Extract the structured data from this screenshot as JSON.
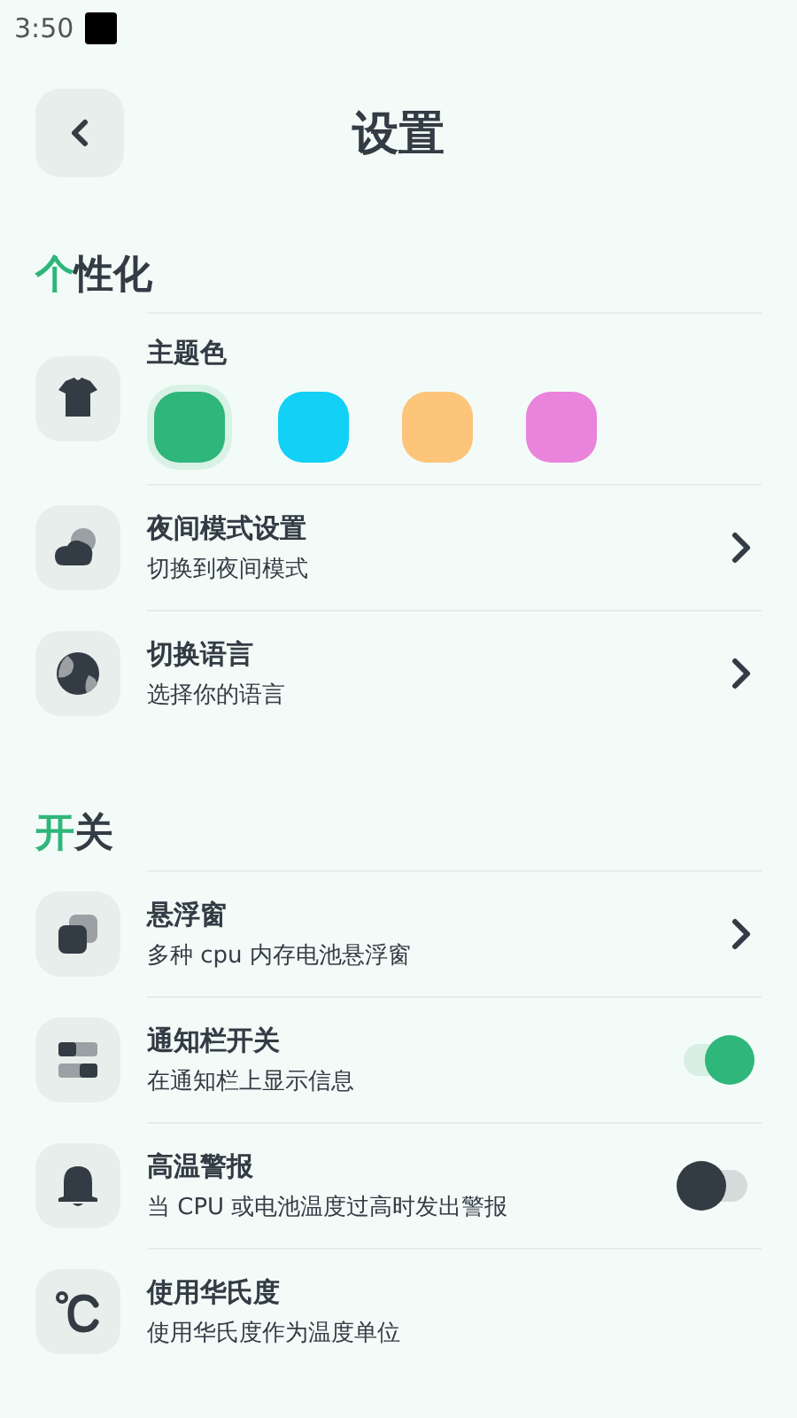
{
  "status_bar": {
    "time": "3:50"
  },
  "header": {
    "title": "设置"
  },
  "sections": [
    {
      "title": {
        "accent": "个",
        "text": "性化"
      },
      "rows": [
        {
          "kind": "swatches",
          "title": "主题色",
          "swatches": [
            {
              "color": "#2fb67a",
              "selected": true
            },
            {
              "color": "#12d0f6",
              "selected": false
            },
            {
              "color": "#fdc57a",
              "selected": false
            },
            {
              "color": "#e983dc",
              "selected": false
            }
          ]
        },
        {
          "kind": "link",
          "title": "夜间模式设置",
          "subtitle": "切换到夜间模式"
        },
        {
          "kind": "link",
          "title": "切换语言",
          "subtitle": "选择你的语言"
        }
      ]
    },
    {
      "title": {
        "accent": "开",
        "text": "关"
      },
      "rows": [
        {
          "kind": "link",
          "title": "悬浮窗",
          "subtitle": "多种 cpu 内存电池悬浮窗"
        },
        {
          "kind": "switch",
          "title": "通知栏开关",
          "subtitle": "在通知栏上显示信息",
          "on": true
        },
        {
          "kind": "switch",
          "title": "高温警报",
          "subtitle": "当 CPU 或电池温度过高时发出警报",
          "on": false
        },
        {
          "kind": "plain",
          "title": "使用华氏度",
          "subtitle": "使用华氏度作为温度单位"
        }
      ]
    }
  ]
}
